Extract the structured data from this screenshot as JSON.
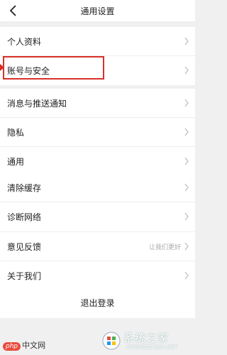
{
  "header": {
    "title": "通用设置",
    "back_icon": "chevron-left-icon"
  },
  "groups": [
    {
      "items": [
        {
          "label": "个人资料"
        },
        {
          "label": "账号与安全",
          "highlighted": true
        }
      ]
    },
    {
      "items": [
        {
          "label": "消息与推送通知"
        },
        {
          "label": "隐私"
        },
        {
          "label": "通用"
        }
      ]
    },
    {
      "items": [
        {
          "label": "清除缓存"
        },
        {
          "label": "诊断网络"
        }
      ]
    },
    {
      "items": [
        {
          "label": "意见反馈",
          "subtext": "让我们更好"
        },
        {
          "label": "关于我们"
        }
      ]
    }
  ],
  "logout_label": "退出登录",
  "colors": {
    "highlight": "#d8302a",
    "background": "#f0f0f0",
    "php_badge": "#e84c3d"
  },
  "watermark_left": {
    "badge": "php",
    "text": "中文网"
  },
  "watermark_right": {
    "title": "系统之家",
    "url": "XITONGZHIJIA.NET"
  }
}
